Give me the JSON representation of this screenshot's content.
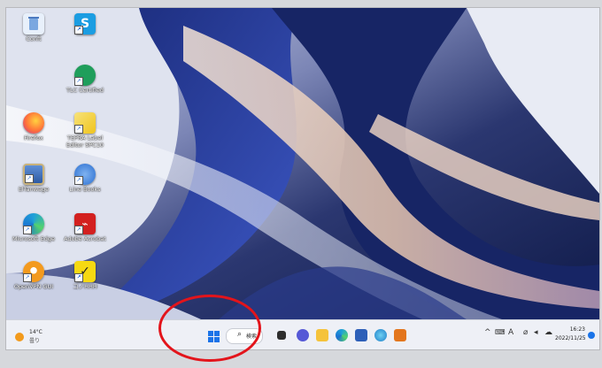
{
  "desktop": {
    "icons": [
      {
        "label": "Conft",
        "icon": "recycle-bin-icon",
        "color": "#e8f0fb"
      },
      {
        "label": "S",
        "icon": "skype-icon",
        "color": "#1b9de2"
      },
      {
        "label": "TLC Certified",
        "icon": "tlc-certified-icon",
        "color": "#1f9e5b"
      },
      {
        "label": "Firefox",
        "icon": "firefox-icon",
        "color": "#ff7139"
      },
      {
        "label": "TEPRA Label Editor SPC10",
        "icon": "tepra-icon",
        "color": "#f0c41c"
      },
      {
        "label": "ElTanwage",
        "icon": "image-app-icon",
        "color": "#3b6fb6"
      },
      {
        "label": "Line Books",
        "icon": "linebooks-icon",
        "color": "#2b6fd1"
      },
      {
        "label": "Microsoft Edge",
        "icon": "edge-icon",
        "color": "#1fa0d9"
      },
      {
        "label": "Adobe Acrobat",
        "icon": "acrobat-icon",
        "color": "#d3201f"
      },
      {
        "label": "OpenVPN GUI",
        "icon": "openvpn-icon",
        "color": "#f39a1e"
      },
      {
        "label": "コノHHH",
        "icon": "norton-check-icon",
        "color": "#f6d912"
      }
    ]
  },
  "taskbar": {
    "weather": {
      "temp": "14°C",
      "cond": "曇り"
    },
    "search_label": "検索",
    "pinned": [
      {
        "icon": "task-view-icon",
        "color": "#2d2d2d"
      },
      {
        "icon": "chat-icon",
        "color": "#5558d6"
      },
      {
        "icon": "file-explorer-icon",
        "color": "#f5c33b"
      },
      {
        "icon": "edge-icon",
        "color": "#1fa0d9"
      },
      {
        "icon": "store-icon",
        "color": "#2d5fb8"
      },
      {
        "icon": "app-icon",
        "color": "#1f7fc9"
      },
      {
        "icon": "outlook-icon",
        "color": "#e3761d"
      }
    ],
    "tray": {
      "chevron": "^",
      "ime": "A",
      "network": "⌀",
      "volume": "◂",
      "cloud": "☁"
    },
    "clock": {
      "time": "16:23",
      "date": "2022/11/25"
    }
  },
  "annotation": {
    "color": "#e3141b"
  }
}
